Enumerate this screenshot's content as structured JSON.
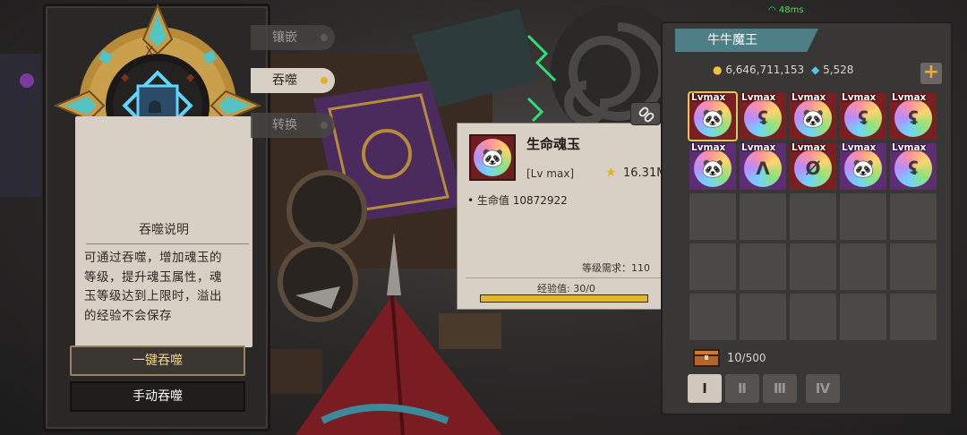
{
  "left": {
    "desc_title": "吞噬说明",
    "desc_text": "可通过吞噬，增加魂玉的等级，提升魂玉属性，魂玉等级达到上限时，溢出的经验不会保存",
    "btn_auto": "一键吞噬",
    "btn_manual": "手动吞噬"
  },
  "tabs": [
    {
      "label": "镶嵌",
      "active": false
    },
    {
      "label": "吞噬",
      "active": true
    },
    {
      "label": "转换",
      "active": false
    }
  ],
  "tooltip": {
    "name": "生命魂玉",
    "level": "[Lv max]",
    "power": "16.31M",
    "hp": "生命值 10872922",
    "requirement": "等级需求：110",
    "exp_label": "经验值: 30/0",
    "exp_progress": 1.0
  },
  "right": {
    "title": "牛牛魔王",
    "gold": "6,646,711,153",
    "gems": "5,528",
    "capacity_current": "10",
    "capacity_max": "/500",
    "slots": [
      {
        "label": "Lvmax",
        "color": "red",
        "glyph": "🐼",
        "selected": true
      },
      {
        "label": "Lvmax",
        "color": "red",
        "glyph": "ʢ"
      },
      {
        "label": "Lvmax",
        "color": "red",
        "glyph": "🐼"
      },
      {
        "label": "Lvmax",
        "color": "red",
        "glyph": "ʢ"
      },
      {
        "label": "Lvmax",
        "color": "red",
        "glyph": "ʢ"
      },
      {
        "label": "Lvmax",
        "color": "purple",
        "glyph": "🐼"
      },
      {
        "label": "Lvmax",
        "color": "purple",
        "glyph": "ᐱ"
      },
      {
        "label": "Lvmax",
        "color": "red",
        "glyph": "Ø"
      },
      {
        "label": "Lvmax",
        "color": "purple",
        "glyph": "🐼"
      },
      {
        "label": "Lvmax",
        "color": "purple",
        "glyph": "ʢ"
      }
    ],
    "filters": [
      {
        "glyph": "Ⅰ",
        "active": true
      },
      {
        "glyph": "Ⅱ",
        "active": false
      },
      {
        "glyph": "Ⅲ",
        "active": false
      },
      {
        "glyph": "Ⅳ",
        "active": false
      }
    ]
  },
  "status": {
    "ping": "48ms"
  }
}
